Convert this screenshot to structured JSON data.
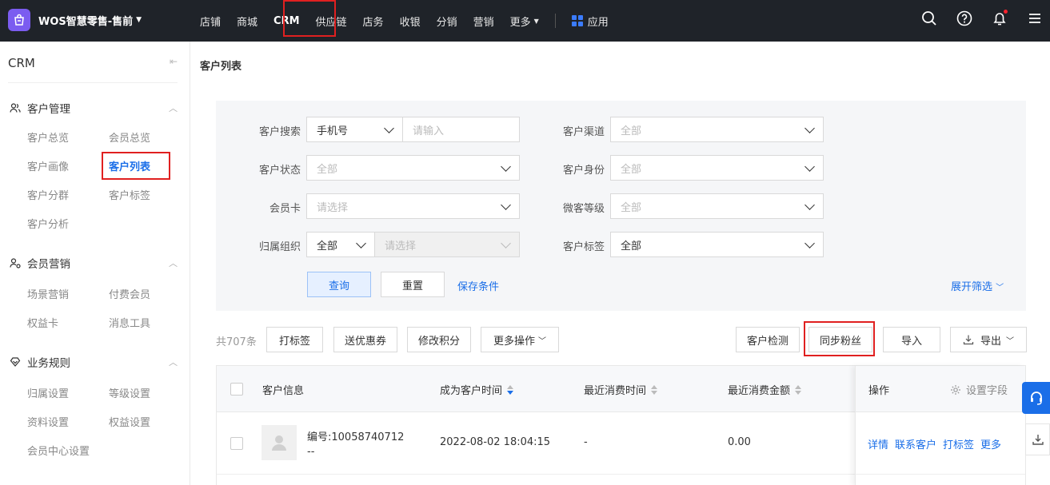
{
  "brand": {
    "name": "WOS智慧零售-售前"
  },
  "nav": {
    "items": [
      "店铺",
      "商城",
      "CRM",
      "供应链",
      "店务",
      "收银",
      "分销",
      "营销",
      "更多"
    ],
    "apps_label": "应用"
  },
  "sidebar": {
    "title": "CRM",
    "groups": [
      {
        "title": "客户管理",
        "items": [
          "客户总览",
          "会员总览",
          "客户画像",
          "客户列表",
          "客户分群",
          "客户标签",
          "客户分析"
        ]
      },
      {
        "title": "会员营销",
        "items": [
          "场景营销",
          "付费会员",
          "权益卡",
          "消息工具"
        ]
      },
      {
        "title": "业务规则",
        "items": [
          "归属设置",
          "等级设置",
          "资料设置",
          "权益设置",
          "会员中心设置"
        ]
      }
    ]
  },
  "page": {
    "title": "客户列表"
  },
  "filters": {
    "customer_search_label": "客户搜索",
    "customer_search_type": "手机号",
    "customer_search_placeholder": "请输入",
    "channel_label": "客户渠道",
    "channel_value": "全部",
    "status_label": "客户状态",
    "status_value": "全部",
    "identity_label": "客户身份",
    "identity_value": "全部",
    "card_label": "会员卡",
    "card_placeholder": "请选择",
    "wk_level_label": "微客等级",
    "wk_level_value": "全部",
    "org_label": "归属组织",
    "org_value": "全部",
    "org_placeholder": "请选择",
    "tag_label": "客户标签",
    "tag_value": "全部",
    "query_button": "查询",
    "reset_button": "重置",
    "save_link": "保存条件",
    "expand_link": "展开筛选"
  },
  "toolbar": {
    "count": "共707条",
    "tag_button": "打标签",
    "coupon_button": "送优惠券",
    "points_button": "修改积分",
    "more_button": "更多操作",
    "check_button": "客户检测",
    "sync_button": "同步粉丝",
    "import_button": "导入",
    "export_button": "导出"
  },
  "table": {
    "headers": {
      "info": "客户信息",
      "became": "成为客户时间",
      "last_time": "最近消费时间",
      "last_amount": "最近消费金额",
      "ops": "操作",
      "settings": "设置字段"
    },
    "rows": [
      {
        "id": "编号:10058740712",
        "sub": "--",
        "became": "2022-08-02 18:04:15",
        "last_time": "-",
        "last_amount": "0.00",
        "ops": [
          "详情",
          "联系客户",
          "打标签",
          "更多"
        ]
      }
    ]
  },
  "colors": {
    "accent": "#1a6ee8",
    "topbar": "#1f2329",
    "highlight": "#e02020"
  }
}
